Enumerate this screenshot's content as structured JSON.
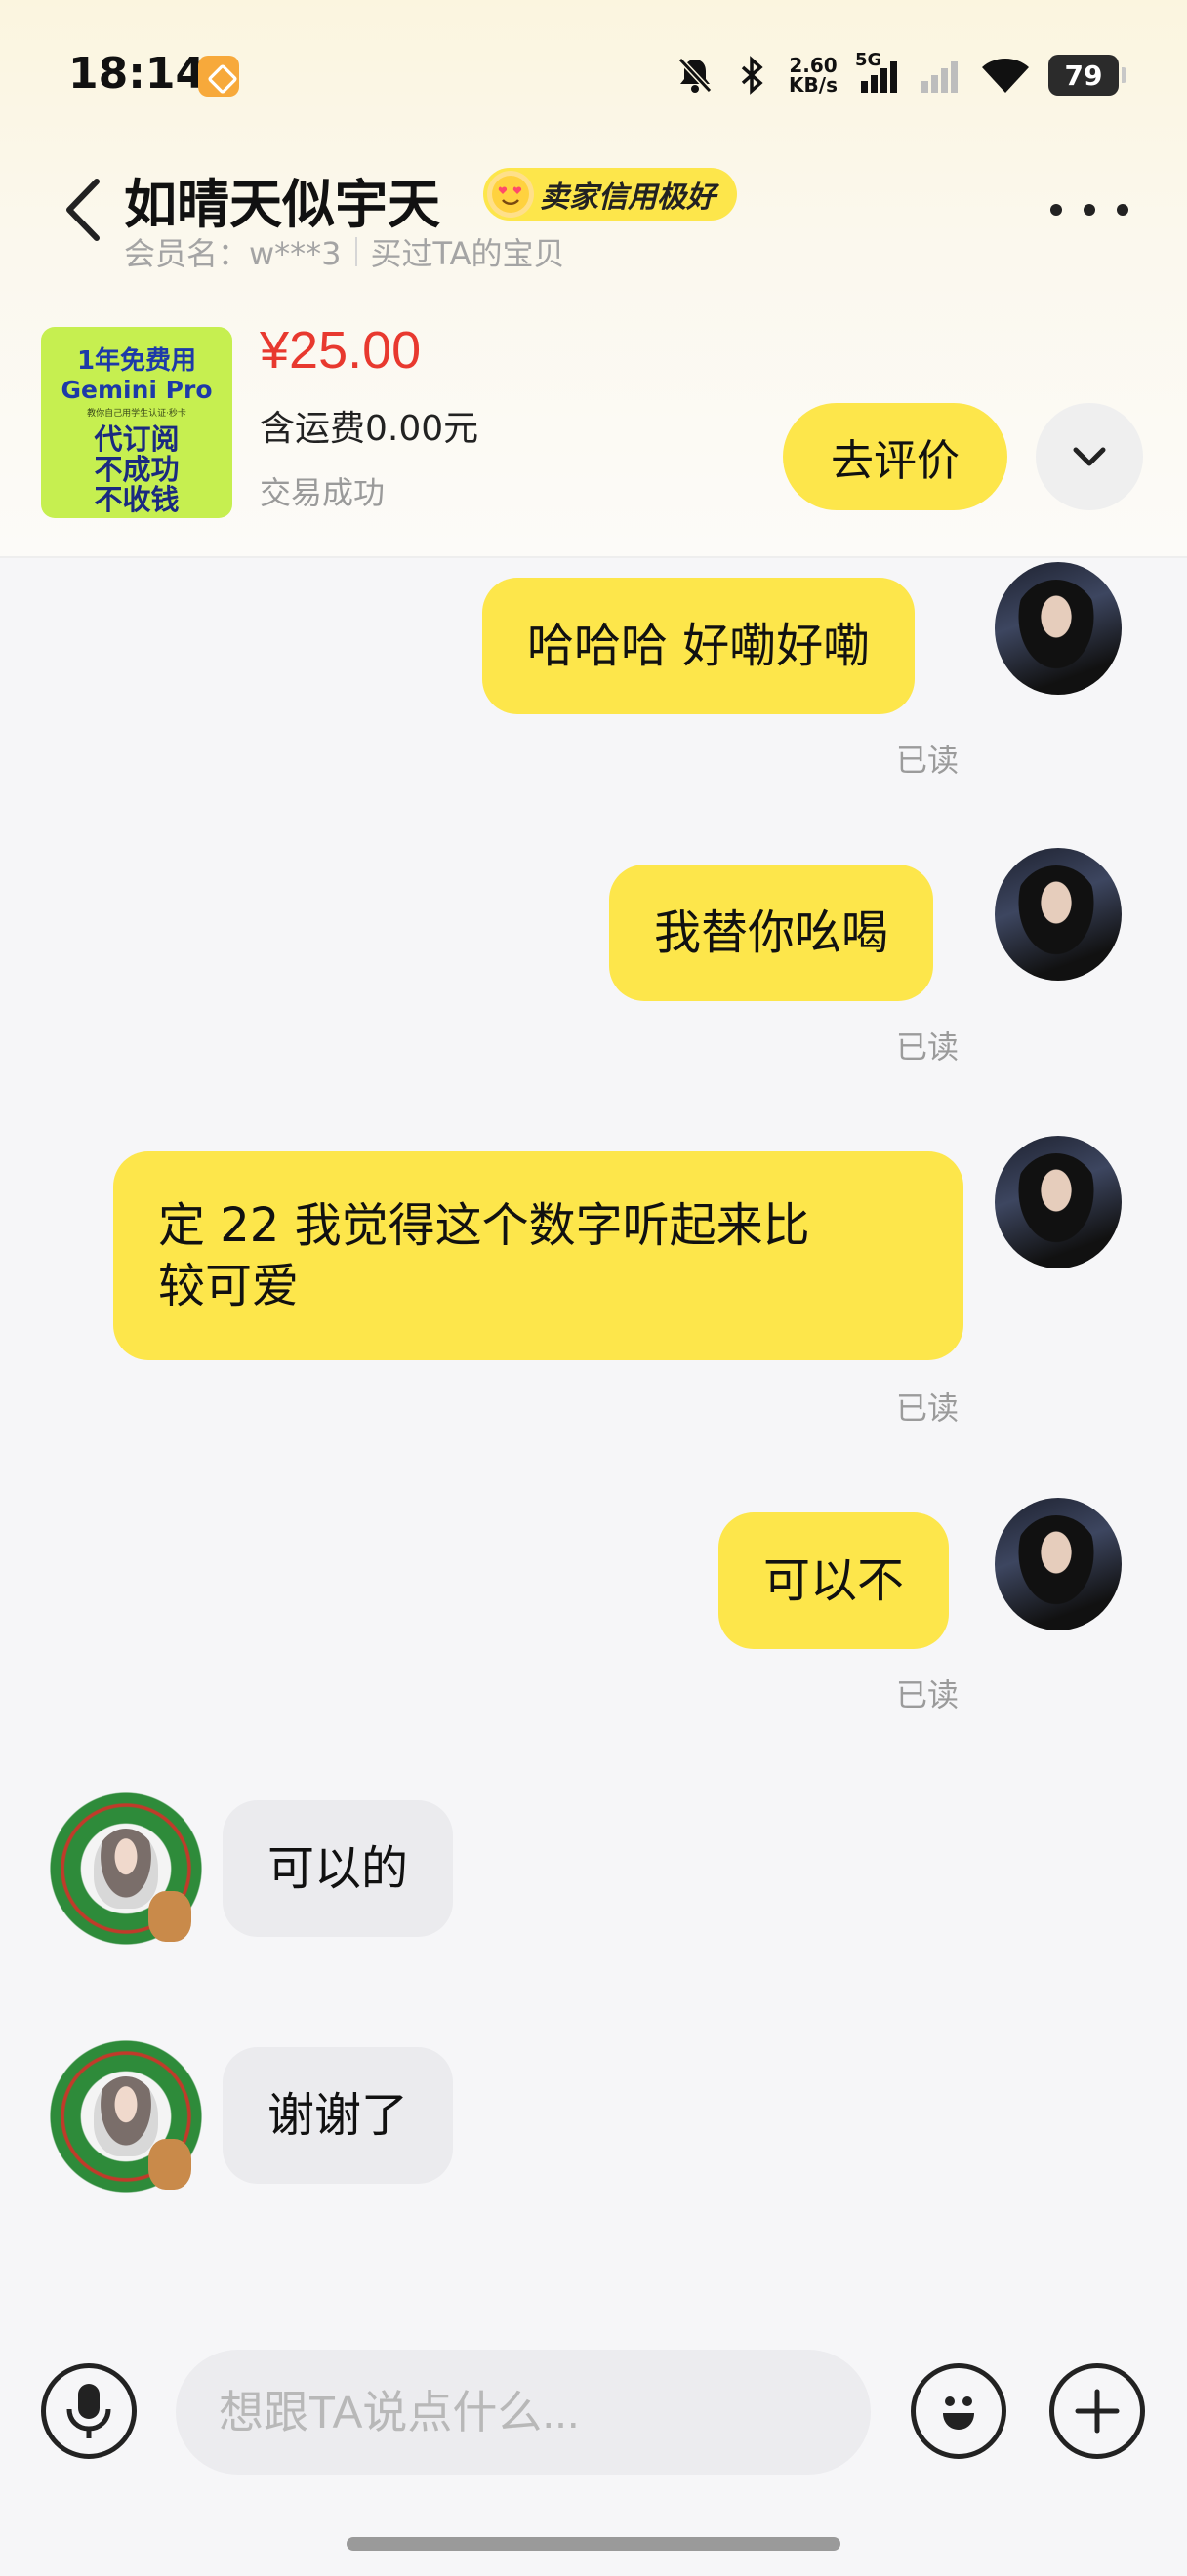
{
  "status_bar": {
    "time": "18:14",
    "net_speed_value": "2.60",
    "net_speed_unit": "KB/s",
    "network": "5G",
    "battery": "79",
    "icons": [
      "app-notification-icon",
      "mute-bell-icon",
      "bluetooth-icon",
      "signal-5g-icon",
      "signal-weak-icon",
      "wifi-icon",
      "battery-icon"
    ]
  },
  "header": {
    "title": "如晴天似宇天",
    "badge": "卖家信用极好",
    "member_label": "会员名：w***3",
    "bought_label": "买过TA的宝贝"
  },
  "product": {
    "thumb": {
      "line1": "1年免费用",
      "line2": "Gemini Pro",
      "line3": "教你自己用学生认证·秒卡",
      "line4": "代订阅",
      "line5": "不成功",
      "line6": "不收钱"
    },
    "price": "¥25.00",
    "shipping": "含运费0.00元",
    "status": "交易成功",
    "review_button": "去评价"
  },
  "messages": [
    {
      "from": "me",
      "text": "哈哈哈 好嘞好嘞",
      "read": "已读"
    },
    {
      "from": "me",
      "text": "我替你吆喝",
      "read": "已读"
    },
    {
      "from": "me",
      "text_line1": "定 22 我觉得这个数字听起来比",
      "text_line2": "较可爱",
      "read": "已读"
    },
    {
      "from": "me",
      "text": "可以不",
      "read": "已读"
    },
    {
      "from": "other",
      "text": "可以的"
    },
    {
      "from": "other",
      "text": "谢谢了"
    }
  ],
  "input": {
    "placeholder": "想跟TA说点什么..."
  },
  "colors": {
    "accent_yellow": "#fde64b",
    "price_red": "#e8392f",
    "other_bubble": "#ebebee",
    "muted_text": "#9b9b9b"
  }
}
